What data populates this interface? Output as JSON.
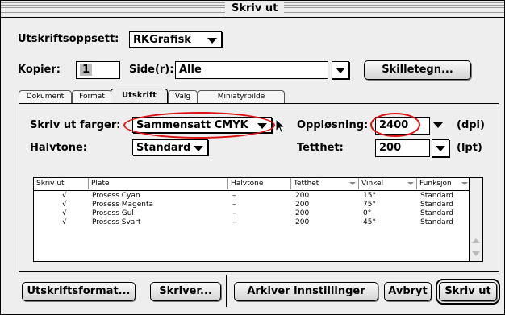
{
  "window": {
    "title": "Skriv ut"
  },
  "setup": {
    "label": "Utskriftsoppsett:",
    "value": "RKGrafisk"
  },
  "copies": {
    "label": "Kopier:",
    "value": "1"
  },
  "pages": {
    "label": "Side(r):",
    "value": "Alle"
  },
  "separator_button": "Skilletegn...",
  "tabs": [
    "Dokument",
    "Format",
    "Utskrift",
    "Valg",
    "Miniatyrbilde"
  ],
  "active_tab": "Utskrift",
  "print_colors": {
    "label": "Skriv ut farger:",
    "value": "Sammensatt CMYK"
  },
  "resolution": {
    "label": "Oppløsning:",
    "value": "2400",
    "unit": "(dpi)"
  },
  "halftone": {
    "label": "Halvtone:",
    "value": "Standard"
  },
  "density": {
    "label": "Tetthet:",
    "value": "200",
    "unit": "(lpt)"
  },
  "table": {
    "headers": [
      "Skriv ut",
      "Plate",
      "Halvtone",
      "Tetthet",
      "Vinkel",
      "Funksjon"
    ],
    "rows": [
      {
        "print": "√",
        "plate": "Prosess Cyan",
        "halftone": "–",
        "density": "200",
        "angle": "15°",
        "function": "Standard"
      },
      {
        "print": "√",
        "plate": "Prosess Magenta",
        "halftone": "–",
        "density": "200",
        "angle": "75°",
        "function": "Standard"
      },
      {
        "print": "√",
        "plate": "Prosess Gul",
        "halftone": "–",
        "density": "200",
        "angle": "0°",
        "function": "Standard"
      },
      {
        "print": "√",
        "plate": "Prosess Svart",
        "halftone": "–",
        "density": "200",
        "angle": "45°",
        "function": "Standard"
      }
    ]
  },
  "buttons": {
    "page_setup": "Utskriftsformat...",
    "printer": "Skriver...",
    "save_settings": "Arkiver innstillinger",
    "cancel": "Avbryt",
    "print": "Skriv ut"
  },
  "highlight_color": "#dd1111"
}
